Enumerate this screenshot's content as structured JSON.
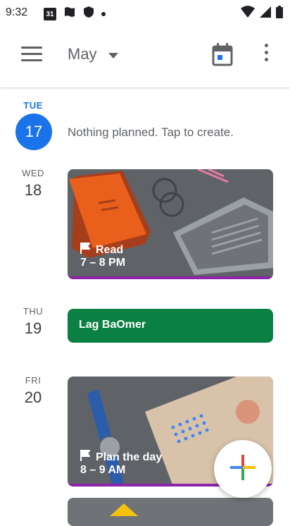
{
  "status": {
    "time": "9:32",
    "calendar_badge": "31"
  },
  "appbar": {
    "month": "May"
  },
  "days": [
    {
      "dow": "TUE",
      "num": "17",
      "empty_text": "Nothing planned. Tap to create."
    },
    {
      "dow": "WED",
      "num": "18"
    },
    {
      "dow": "THU",
      "num": "19"
    },
    {
      "dow": "FRI",
      "num": "20"
    }
  ],
  "events": [
    {
      "title": "Read",
      "time": "7 – 8 PM"
    },
    {
      "title": "Lag BaOmer"
    },
    {
      "title": "Plan the day",
      "time": "8 – 9 AM"
    }
  ],
  "colors": {
    "accent": "#1a73e8",
    "holiday": "#0b8043",
    "event_line": "#8e24aa"
  },
  "icons": [
    "menu-icon",
    "dropdown-icon",
    "today-icon",
    "more-vert-icon",
    "flag-icon",
    "add-icon"
  ]
}
